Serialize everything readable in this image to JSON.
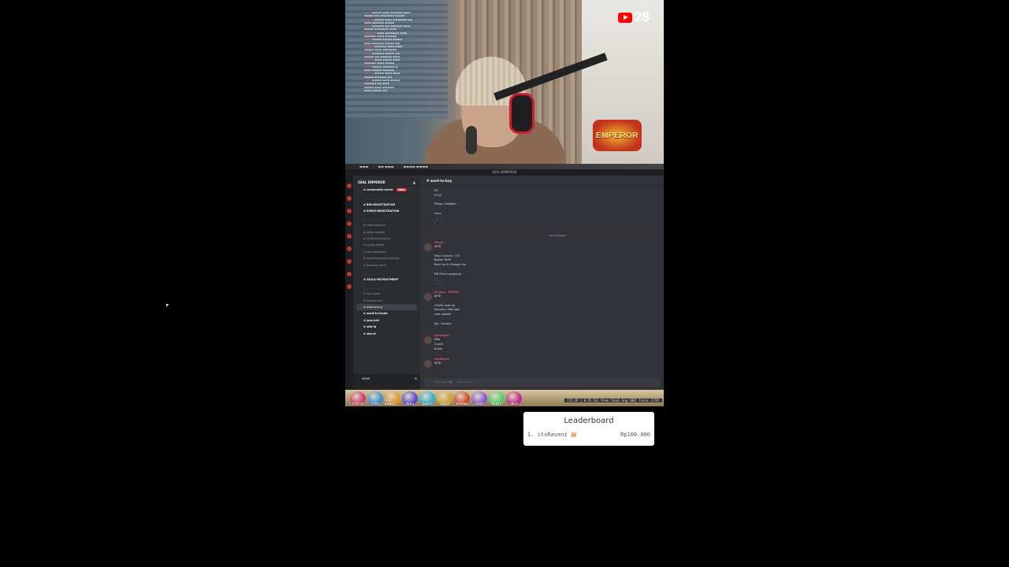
{
  "stream": {
    "viewer_count": "28",
    "overlay_logo": "EMPEROR",
    "icons": {
      "viewers": "youtube-icon"
    }
  },
  "discord": {
    "window_title": "SEAL EMPEROR",
    "server_name": "SEAL EMPEROR",
    "channels": [
      {
        "label": "# community-event",
        "bold": true,
        "badge": "NEW"
      },
      {
        "label": "# BIN-REGISTRATION",
        "bold": true
      },
      {
        "label": "# EVENT-REGISTRATION",
        "bold": true
      },
      {
        "label": "# kitab-emperor"
      },
      {
        "label": "# guide-request"
      },
      {
        "label": "# all-about-emperor"
      },
      {
        "label": "# candy-village"
      },
      {
        "label": "# uap-pelaparan"
      },
      {
        "label": "# upcoming-event-trading"
      },
      {
        "label": "# emperor-event"
      },
      {
        "label": "# GUILD-RECRUITMENT",
        "bold": true
      },
      {
        "label": "# mau-ganti"
      },
      {
        "label": "# want-to-sell"
      },
      {
        "label": "# want-to-buy",
        "active": true
      },
      {
        "label": "# want-to-trade",
        "bold": true
      },
      {
        "label": "# jasa-joki",
        "bold": true
      },
      {
        "label": "# wtb-id",
        "bold": true
      },
      {
        "label": "# wts-id",
        "bold": true
      }
    ],
    "user": "ATAMI",
    "active_channel": "# want-to-buy",
    "new_messages_label": "new messages",
    "messages": [
      {
        "lines": "FD\nFFUJI\n\nPalwa / Dalabdi\n\nLano",
        "reaction": "2"
      },
      {
        "author": "Kicok",
        "lines": "WTB\n\nPelor Gunner +10\nBahan MCM\nRed Ore & Orange Ore\n\nPM Price Langsung",
        "reaction": "3"
      },
      {
        "author": "Arcaya · FNOMI",
        "lines": "WTB\n\nCEGEL take all\nbanyak / dikit gas\nrate update\n\nign : Arcaya"
      },
      {
        "author": "Zerotiger",
        "lines": "Wtb\nCrupit\nBroke"
      },
      {
        "author": "thaihanis",
        "lines": "WTB"
      }
    ],
    "composer_placeholder": "Message #🛒 · want-to-buy"
  },
  "gamebar": {
    "buttons": [
      "STATUS",
      "ITEM",
      "ITEM BANK",
      "SKILL",
      "QUEST",
      "QUICK",
      "FRIEND",
      "CHAT",
      "PARTY",
      "HELP"
    ],
    "status_text": "[12:29 | 0:35:53] Prem [Seal Eng 100] Field [179]"
  },
  "leaderboard": {
    "title": "Leaderboard",
    "entries": [
      {
        "rank": "1.",
        "name": "itsRavenz 🐹",
        "amount": "Rp100.000"
      }
    ]
  }
}
